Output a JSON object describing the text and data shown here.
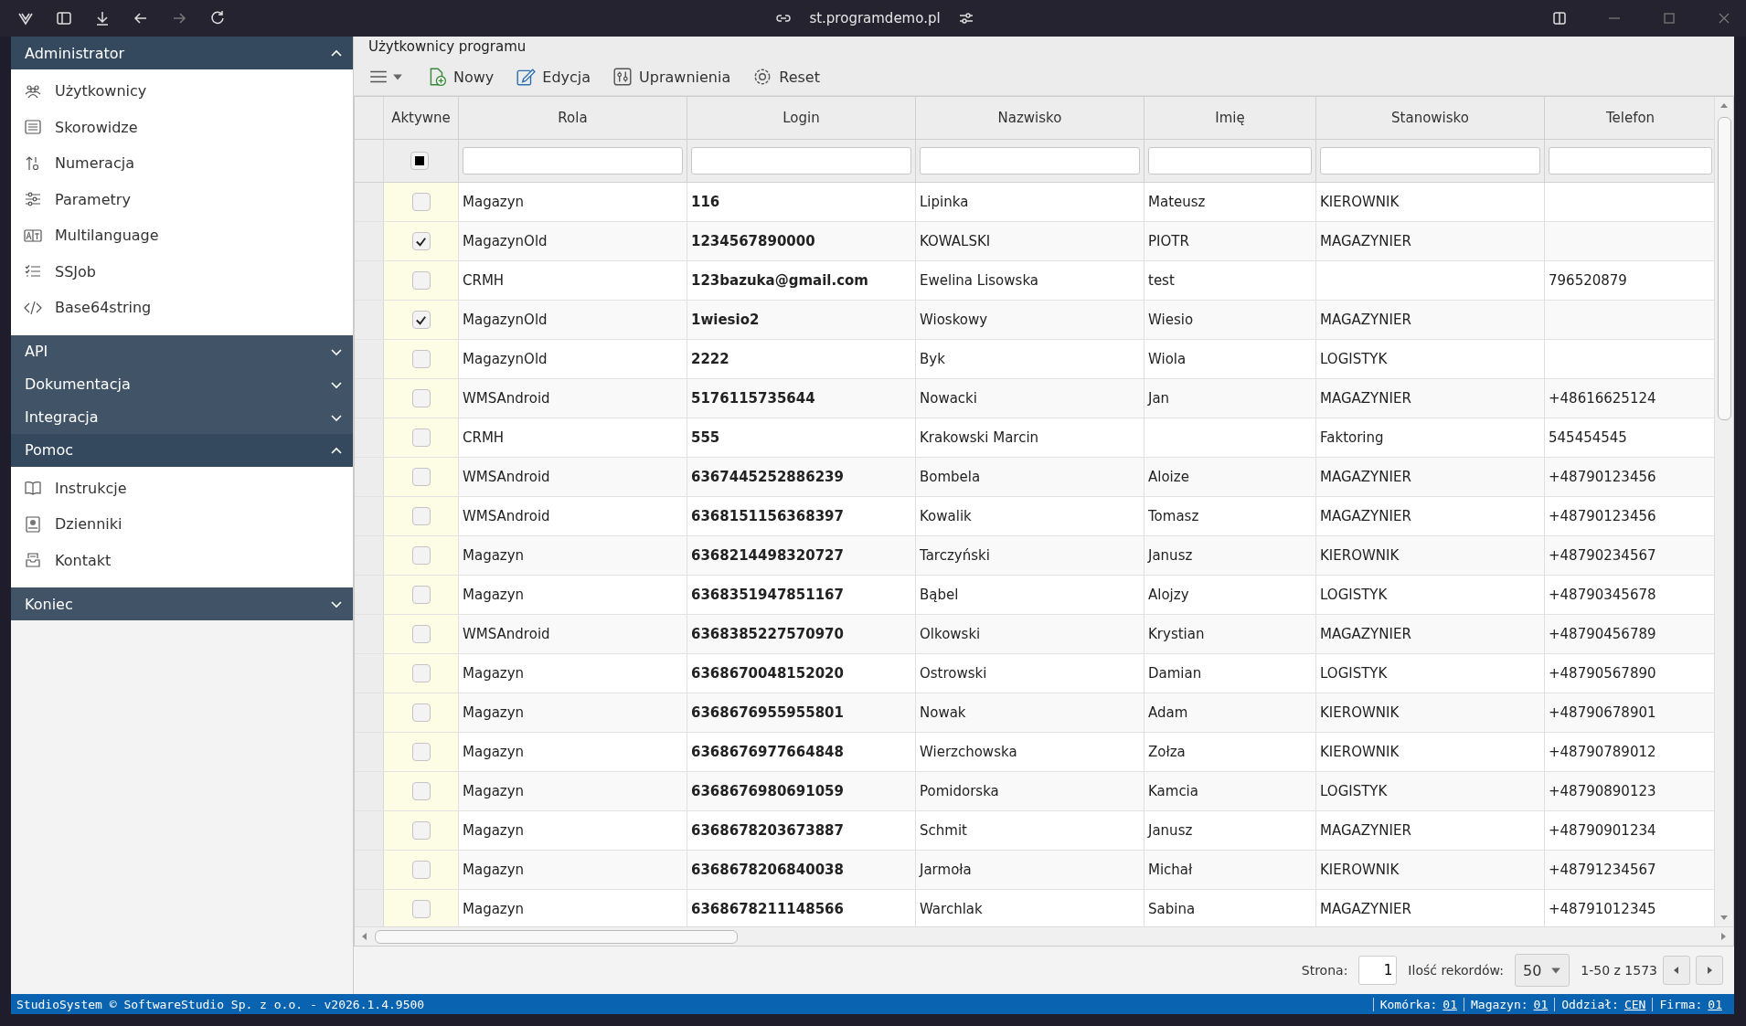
{
  "browser": {
    "address": "st.programdemo.pl"
  },
  "sidebar": {
    "groups": [
      {
        "title": "Administrator",
        "expanded": true,
        "items": [
          {
            "label": "Użytkownicy"
          },
          {
            "label": "Skorowidze"
          },
          {
            "label": "Numeracja"
          },
          {
            "label": "Parametry"
          },
          {
            "label": "Multilanguage"
          },
          {
            "label": "SSJob"
          },
          {
            "label": "Base64string"
          }
        ]
      },
      {
        "title": "API",
        "expanded": false
      },
      {
        "title": "Dokumentacja",
        "expanded": false
      },
      {
        "title": "Integracja",
        "expanded": false
      },
      {
        "title": "Pomoc",
        "expanded": true,
        "items": [
          {
            "label": "Instrukcje"
          },
          {
            "label": "Dzienniki"
          },
          {
            "label": "Kontakt"
          }
        ]
      },
      {
        "title": "Koniec",
        "expanded": false
      }
    ]
  },
  "panel": {
    "title": "Użytkownicy programu"
  },
  "toolbar": {
    "buttons": [
      {
        "label": "Nowy"
      },
      {
        "label": "Edycja"
      },
      {
        "label": "Uprawnienia"
      },
      {
        "label": "Reset"
      }
    ]
  },
  "table": {
    "checkbox_column": {
      "title": "Aktywne",
      "filter_indeterminate": true
    },
    "columns": [
      "Rola",
      "Login",
      "Nazwisko",
      "Imię",
      "Stanowisko",
      "Telefon"
    ],
    "rows": [
      {
        "active": false,
        "cells": [
          "Magazyn",
          "116",
          "Lipinka",
          "Mateusz",
          "KIEROWNIK",
          ""
        ]
      },
      {
        "active": true,
        "cells": [
          "MagazynOld",
          "1234567890000",
          "KOWALSKI",
          "PIOTR",
          "MAGAZYNIER",
          ""
        ]
      },
      {
        "active": false,
        "cells": [
          "CRMH",
          "123bazuka@gmail.com",
          "Ewelina Lisowska",
          "test",
          "",
          "796520879"
        ]
      },
      {
        "active": true,
        "cells": [
          "MagazynOld",
          "1wiesio2",
          "Wioskowy",
          "Wiesio",
          "MAGAZYNIER",
          ""
        ]
      },
      {
        "active": false,
        "cells": [
          "MagazynOld",
          "2222",
          "Byk",
          "Wiola",
          "LOGISTYK",
          ""
        ]
      },
      {
        "active": false,
        "cells": [
          "WMSAndroid",
          "5176115735644",
          "Nowacki",
          "Jan",
          "MAGAZYNIER",
          "+48616625124"
        ]
      },
      {
        "active": false,
        "cells": [
          "CRMH",
          "555",
          "Krakowski Marcin",
          "",
          "Faktoring",
          "545454545"
        ]
      },
      {
        "active": false,
        "cells": [
          "WMSAndroid",
          "6367445252886239",
          "Bombela",
          "Aloize",
          "MAGAZYNIER",
          "+48790123456"
        ]
      },
      {
        "active": false,
        "cells": [
          "WMSAndroid",
          "6368151156368397",
          "Kowalik",
          "Tomasz",
          "MAGAZYNIER",
          "+48790123456"
        ]
      },
      {
        "active": false,
        "cells": [
          "Magazyn",
          "6368214498320727",
          "Tarczyński",
          "Janusz",
          "KIEROWNIK",
          "+48790234567"
        ]
      },
      {
        "active": false,
        "cells": [
          "Magazyn",
          "6368351947851167",
          "Bąbel",
          "Alojzy",
          "LOGISTYK",
          "+48790345678"
        ]
      },
      {
        "active": false,
        "cells": [
          "WMSAndroid",
          "6368385227570970",
          "Olkowski",
          "Krystian",
          "MAGAZYNIER",
          "+48790456789"
        ]
      },
      {
        "active": false,
        "cells": [
          "Magazyn",
          "6368670048152020",
          "Ostrowski",
          "Damian",
          "LOGISTYK",
          "+48790567890"
        ]
      },
      {
        "active": false,
        "cells": [
          "Magazyn",
          "6368676955955801",
          "Nowak",
          "Adam",
          "KIEROWNIK",
          "+48790678901"
        ]
      },
      {
        "active": false,
        "cells": [
          "Magazyn",
          "6368676977664848",
          "Wierzchowska",
          "Zołza",
          "KIEROWNIK",
          "+48790789012"
        ]
      },
      {
        "active": false,
        "cells": [
          "Magazyn",
          "6368676980691059",
          "Pomidorska",
          "Kamcia",
          "LOGISTYK",
          "+48790890123"
        ]
      },
      {
        "active": false,
        "cells": [
          "Magazyn",
          "6368678203673887",
          "Schmit",
          "Janusz",
          "MAGAZYNIER",
          "+48790901234"
        ]
      },
      {
        "active": false,
        "cells": [
          "Magazyn",
          "6368678206840038",
          "Jarmoła",
          "Michał",
          "KIEROWNIK",
          "+48791234567"
        ]
      },
      {
        "active": false,
        "cells": [
          "Magazyn",
          "6368678211148566",
          "Warchlak",
          "Sabina",
          "MAGAZYNIER",
          "+48791012345"
        ]
      }
    ]
  },
  "pager": {
    "page_label": "Strona:",
    "page": "1",
    "count_label": "Ilość rekordów:",
    "page_size": "50",
    "range": "1-50 z 1573"
  },
  "status_bar": {
    "left": "StudioSystem © SoftwareStudio Sp. z o.o. - v2026.1.4.9500",
    "fields": [
      {
        "label": "Komórka:",
        "value": "01"
      },
      {
        "label": "Magazyn:",
        "value": "01"
      },
      {
        "label": "Oddział:",
        "value": "CEN"
      },
      {
        "label": "Firma:",
        "value": "01"
      }
    ]
  }
}
